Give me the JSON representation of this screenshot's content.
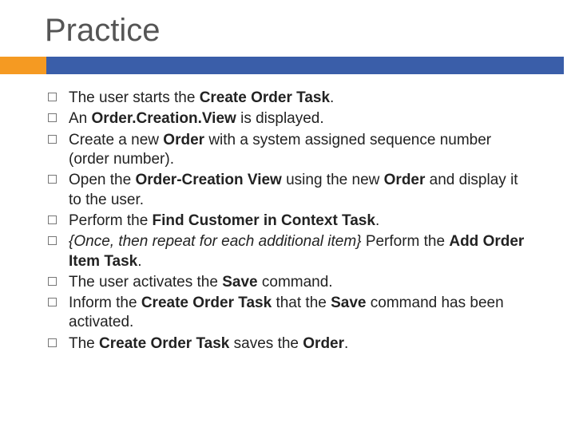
{
  "title": "Practice",
  "items": [
    {
      "segments": [
        {
          "t": "The user starts the "
        },
        {
          "t": "Create Order Task",
          "b": true
        },
        {
          "t": "."
        }
      ]
    },
    {
      "segments": [
        {
          "t": "An "
        },
        {
          "t": "Order.Creation.View",
          "b": true
        },
        {
          "t": " is displayed."
        }
      ]
    },
    {
      "segments": [
        {
          "t": "Create a new "
        },
        {
          "t": "Order",
          "b": true
        },
        {
          "t": " with a system assigned sequence number (order number)."
        }
      ]
    },
    {
      "segments": [
        {
          "t": "Open the "
        },
        {
          "t": "Order-Creation View",
          "b": true
        },
        {
          "t": " using the new "
        },
        {
          "t": "Order",
          "b": true
        },
        {
          "t": " and display it to the user."
        }
      ]
    },
    {
      "segments": [
        {
          "t": "Perform the "
        },
        {
          "t": "Find Customer in Context Task",
          "b": true
        },
        {
          "t": "."
        }
      ]
    },
    {
      "segments": [
        {
          "t": "{Once, then repeat for each additional item} ",
          "i": true
        },
        {
          "t": "Perform the "
        },
        {
          "t": "Add Order Item Task",
          "b": true
        },
        {
          "t": "."
        }
      ]
    },
    {
      "segments": [
        {
          "t": "The user activates the "
        },
        {
          "t": "Save",
          "b": true
        },
        {
          "t": " command."
        }
      ]
    },
    {
      "segments": [
        {
          "t": "Inform the "
        },
        {
          "t": "Create Order Task",
          "b": true
        },
        {
          "t": " that the "
        },
        {
          "t": "Save",
          "b": true
        },
        {
          "t": " command has been activated."
        }
      ]
    },
    {
      "segments": [
        {
          "t": "The "
        },
        {
          "t": "Create Order Task",
          "b": true
        },
        {
          "t": " saves the "
        },
        {
          "t": "Order",
          "b": true
        },
        {
          "t": "."
        }
      ]
    }
  ]
}
